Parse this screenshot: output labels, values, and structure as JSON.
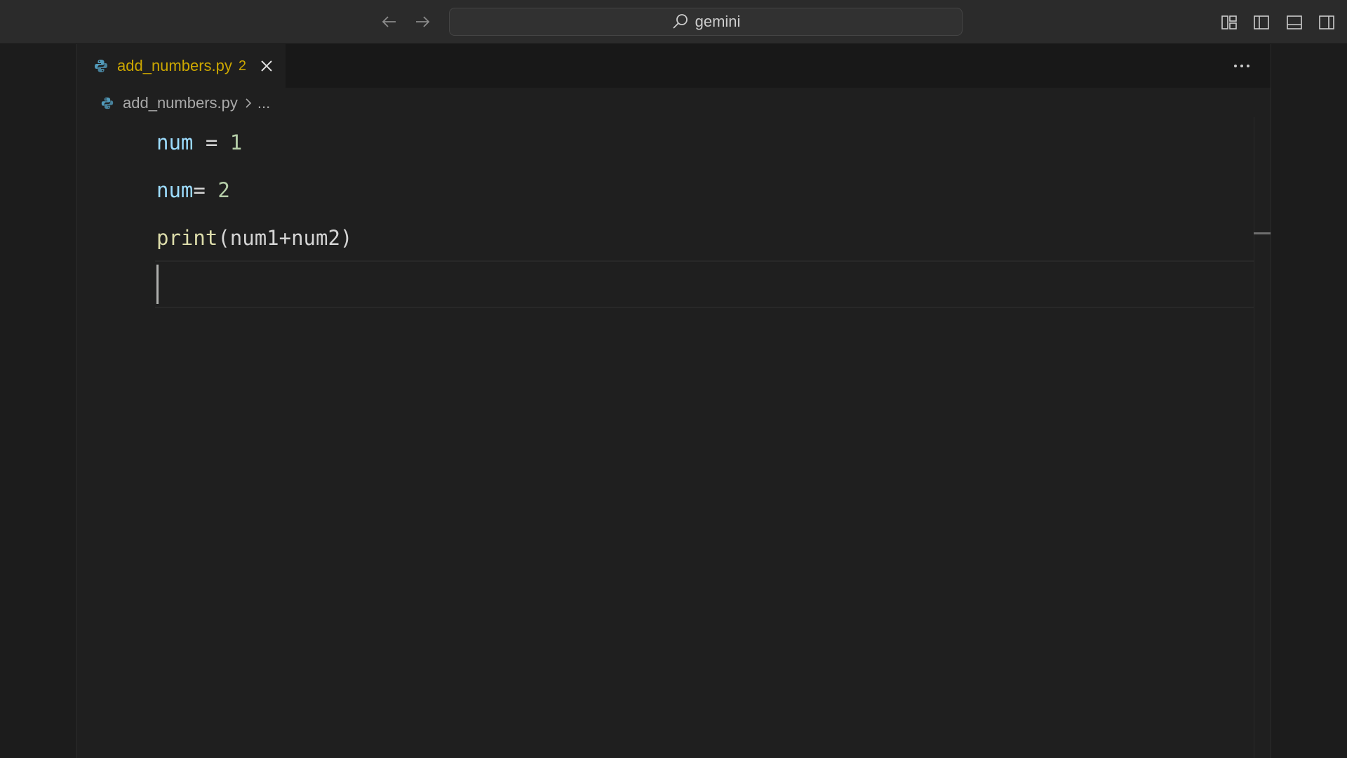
{
  "titlebar": {
    "search_text": "gemini"
  },
  "tab": {
    "file_name": "add_numbers.py",
    "problem_count": "2",
    "label_color": "#cca700"
  },
  "breadcrumb": {
    "file_name": "add_numbers.py",
    "more": "..."
  },
  "code": {
    "line1": {
      "var": "num",
      "op": " = ",
      "num": "1"
    },
    "line2": {
      "var": "num",
      "op": "= ",
      "num": "2"
    },
    "line3": {
      "fn": "print",
      "args": "(num1+num2)"
    }
  },
  "icons": {
    "back": "arrow-left-icon",
    "forward": "arrow-right-icon",
    "search": "search-icon",
    "python": "python-icon",
    "close": "close-icon",
    "more": "ellipsis-icon",
    "layout_customize": "customize-layout-icon",
    "toggle_primary_sidebar": "sidebar-left-icon",
    "toggle_panel": "panel-bottom-icon",
    "toggle_secondary_sidebar": "sidebar-right-icon"
  },
  "colors": {
    "background": "#1f1f1f",
    "titlebar": "#2b2b2b",
    "variable": "#9cdcfe",
    "number": "#b5cea8",
    "function": "#dcdcaa"
  }
}
